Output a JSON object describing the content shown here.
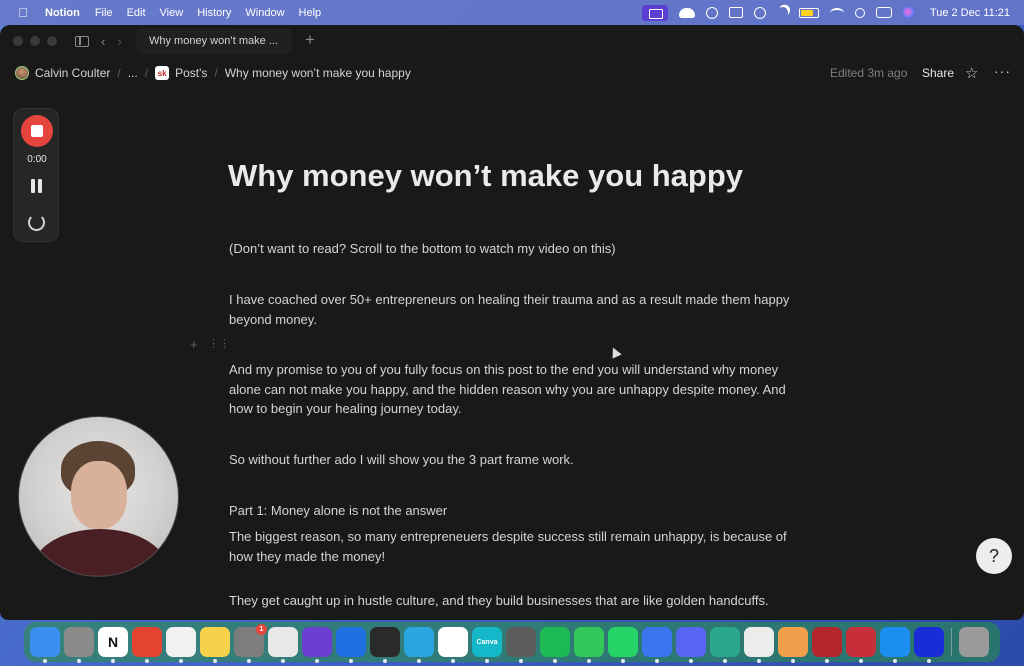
{
  "menubar": {
    "app_name": "Notion",
    "menus": [
      "File",
      "Edit",
      "View",
      "History",
      "Window",
      "Help"
    ],
    "clock": "Tue 2 Dec  11:21"
  },
  "tab": {
    "title": "Why money won’t make ..."
  },
  "breadcrumb": {
    "workspace": "Calvin Coulter",
    "ellipsis": "...",
    "page_icon": "sk",
    "section": "Post's",
    "current": "Why money won’t make you happy"
  },
  "topbar": {
    "edited": "Edited 3m ago",
    "share": "Share"
  },
  "recorder": {
    "time": "0:00"
  },
  "page": {
    "title": "Why money won’t make you happy",
    "paragraphs": [
      "(Don’t want to read? Scroll to the bottom to watch my video on this)",
      "I have coached over 50+ entrepreneurs on healing their trauma and as a result made them happy beyond money.",
      "And my promise to you of you fully focus on this post to the end you will understand why money alone can not make you happy, and the hidden reason why you are unhappy despite money. And how to begin your healing journey today.",
      "So without further ado I will show you the 3 part frame work.",
      "Part 1: Money alone is not the answer",
      "The biggest reason, so many entrepreneuers despite success still remain unhappy, is because of how they made the money!",
      "They get caught up in hustle culture, and they build businesses that are like golden handcuffs."
    ]
  },
  "dock": {
    "apps": [
      {
        "name": "finder-app",
        "color": "#3b8ff0",
        "label": "",
        "badge": ""
      },
      {
        "name": "launchpad-app",
        "color": "#8a8a8a",
        "label": "",
        "badge": ""
      },
      {
        "name": "notion-app",
        "color": "#ffffff",
        "label": "N",
        "badge": ""
      },
      {
        "name": "todoist-app",
        "color": "#e44332",
        "label": "",
        "badge": ""
      },
      {
        "name": "reminders-app",
        "color": "#f2f2f2",
        "label": "",
        "badge": ""
      },
      {
        "name": "notes-app",
        "color": "#f5d24a",
        "label": "",
        "badge": ""
      },
      {
        "name": "system-settings-app",
        "color": "#7d7d7d",
        "label": "",
        "badge": "1"
      },
      {
        "name": "chrome-app",
        "color": "#e8e8e8",
        "label": "",
        "badge": ""
      },
      {
        "name": "arc-app",
        "color": "#6b3fd1",
        "label": "",
        "badge": ""
      },
      {
        "name": "screenflow-app",
        "color": "#1f6fe0",
        "label": "",
        "badge": ""
      },
      {
        "name": "voice-memos-app",
        "color": "#2a2a2a",
        "label": "",
        "badge": ""
      },
      {
        "name": "telegram-app",
        "color": "#2ba5e0",
        "label": "",
        "badge": ""
      },
      {
        "name": "capcut-app",
        "color": "#ffffff",
        "label": "",
        "badge": ""
      },
      {
        "name": "canva-app",
        "color": "#14b8c8",
        "label": "Canva",
        "badge": ""
      },
      {
        "name": "grammarly-app",
        "color": "#5c5c5c",
        "label": "",
        "badge": ""
      },
      {
        "name": "spotify-app",
        "color": "#1db954",
        "label": "",
        "badge": ""
      },
      {
        "name": "messages-app",
        "color": "#34c759",
        "label": "",
        "badge": ""
      },
      {
        "name": "whatsapp-app",
        "color": "#25d366",
        "label": "",
        "badge": ""
      },
      {
        "name": "signal-app",
        "color": "#3a76f0",
        "label": "",
        "badge": ""
      },
      {
        "name": "discord-app",
        "color": "#5865f2",
        "label": "",
        "badge": ""
      },
      {
        "name": "skool-app",
        "color": "#2aa68a",
        "label": "",
        "badge": ""
      },
      {
        "name": "chatgpt-app",
        "color": "#ececec",
        "label": "",
        "badge": ""
      },
      {
        "name": "photos-app",
        "color": "#f0a04b",
        "label": "",
        "badge": ""
      },
      {
        "name": "photo-booth-app",
        "color": "#b3262d",
        "label": "",
        "badge": ""
      },
      {
        "name": "quill-app",
        "color": "#c62e3a",
        "label": "",
        "badge": ""
      },
      {
        "name": "app-store-app",
        "color": "#1c8ef2",
        "label": "",
        "badge": ""
      },
      {
        "name": "screen-studio-app",
        "color": "#1a2bd8",
        "label": "",
        "badge": ""
      }
    ],
    "trash": {
      "name": "trash-app",
      "color": "#9a9a9a"
    }
  }
}
